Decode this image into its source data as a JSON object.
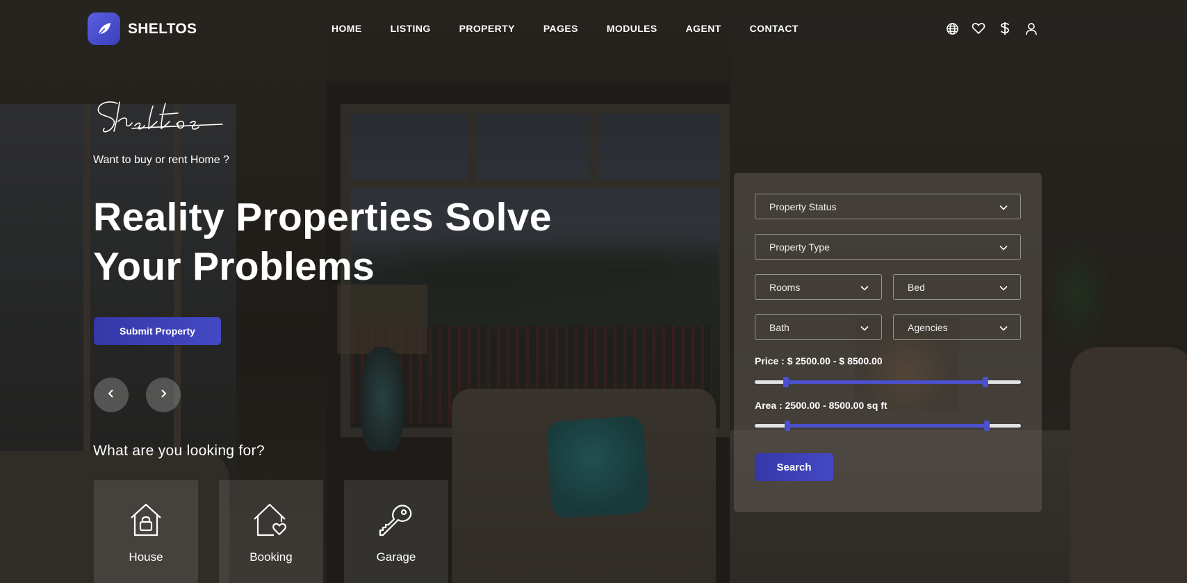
{
  "brand": {
    "name": "SHELTOS",
    "logo_icon": "leaf-icon"
  },
  "nav": {
    "items": [
      "HOME",
      "LISTING",
      "PROPERTY",
      "PAGES",
      "MODULES",
      "AGENT",
      "CONTACT"
    ]
  },
  "header_icons": [
    "globe-icon",
    "heart-icon",
    "dollar-icon",
    "user-icon"
  ],
  "hero": {
    "signature": "Sheltos",
    "tagline": "Want to buy or rent Home ?",
    "title_line1": "Reality Properties Solve",
    "title_line2": "Your Problems",
    "submit_label": "Submit Property",
    "prev_icon": "chevron-left-icon",
    "next_icon": "chevron-right-icon"
  },
  "looking": {
    "heading": "What are you looking for?",
    "categories": [
      {
        "label": "House",
        "icon": "house-lock-icon"
      },
      {
        "label": "Booking",
        "icon": "house-heart-icon"
      },
      {
        "label": "Garage",
        "icon": "key-icon"
      }
    ]
  },
  "search": {
    "property_status": "Property Status",
    "property_type": "Property Type",
    "rooms": "Rooms",
    "bed": "Bed",
    "bath": "Bath",
    "agencies": "Agencies",
    "price_label": "Price : $ 2500.00 - $ 8500.00",
    "price_range": {
      "min": 2500,
      "max": 8500
    },
    "area_label": "Area : 2500.00 - 8500.00 sq ft",
    "area_range": {
      "min": 2500,
      "max": 8500
    },
    "search_label": "Search"
  },
  "colors": {
    "accent": "#4349c4",
    "accent_dark": "#3538a8",
    "slider_track": "#e3e3e3"
  }
}
